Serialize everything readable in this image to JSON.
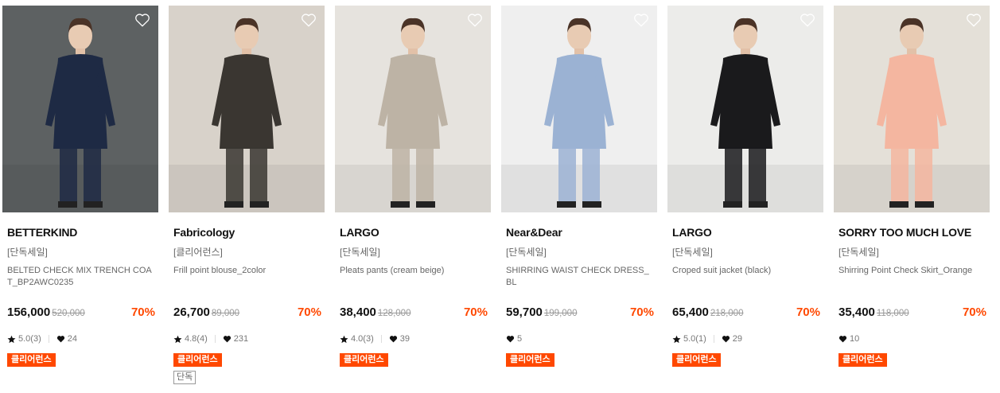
{
  "products": [
    {
      "brand": "BETTERKIND",
      "tag": "[단독세일]",
      "name": "BELTED CHECK MIX TRENCH COAT_BP2AWC0235",
      "price": "156,000",
      "original_price": "520,000",
      "discount": "70%",
      "rating": "5.0(3)",
      "likes": "24",
      "badges": [
        "클리어런스"
      ],
      "bg_color": "#5d6162",
      "garment_color": "#1e2a44",
      "like_icon": "heart-outline-icon"
    },
    {
      "brand": "Fabricology",
      "tag": "[클리어런스]",
      "name": "Frill point blouse_2color",
      "price": "26,700",
      "original_price": "89,000",
      "discount": "70%",
      "rating": "4.8(4)",
      "likes": "231",
      "badges": [
        "클리어런스",
        "단독"
      ],
      "bg_color": "#d8d2ca",
      "garment_color": "#3a3631",
      "like_icon": "heart-outline-icon"
    },
    {
      "brand": "LARGO",
      "tag": "[단독세일]",
      "name": "Pleats pants (cream beige)",
      "price": "38,400",
      "original_price": "128,000",
      "discount": "70%",
      "rating": "4.0(3)",
      "likes": "39",
      "badges": [
        "클리어런스"
      ],
      "bg_color": "#e6e3de",
      "garment_color": "#bdb3a5",
      "like_icon": "heart-outline-icon"
    },
    {
      "brand": "Near&Dear",
      "tag": "[단독세일]",
      "name": "SHIRRING WAIST CHECK DRESS_BL",
      "price": "59,700",
      "original_price": "199,000",
      "discount": "70%",
      "rating": "",
      "likes": "5",
      "badges": [
        "클리어런스"
      ],
      "bg_color": "#efefef",
      "garment_color": "#9bb2d3",
      "like_icon": "heart-outline-icon"
    },
    {
      "brand": "LARGO",
      "tag": "[단독세일]",
      "name": "Croped suit jacket (black)",
      "price": "65,400",
      "original_price": "218,000",
      "discount": "70%",
      "rating": "5.0(1)",
      "likes": "29",
      "badges": [
        "클리어런스"
      ],
      "bg_color": "#ececea",
      "garment_color": "#1a1a1c",
      "like_icon": "heart-outline-icon"
    },
    {
      "brand": "SORRY TOO MUCH LOVE",
      "tag": "[단독세일]",
      "name": "Shirring Point Check Skirt_Orange",
      "price": "35,400",
      "original_price": "118,000",
      "discount": "70%",
      "rating": "",
      "likes": "10",
      "badges": [
        "클리어런스"
      ],
      "bg_color": "#e4e0d8",
      "garment_color": "#f4b6a0",
      "like_icon": "heart-outline-icon"
    }
  ],
  "colors": {
    "accent": "#ff4800",
    "text": "#111111",
    "muted": "#666666"
  }
}
